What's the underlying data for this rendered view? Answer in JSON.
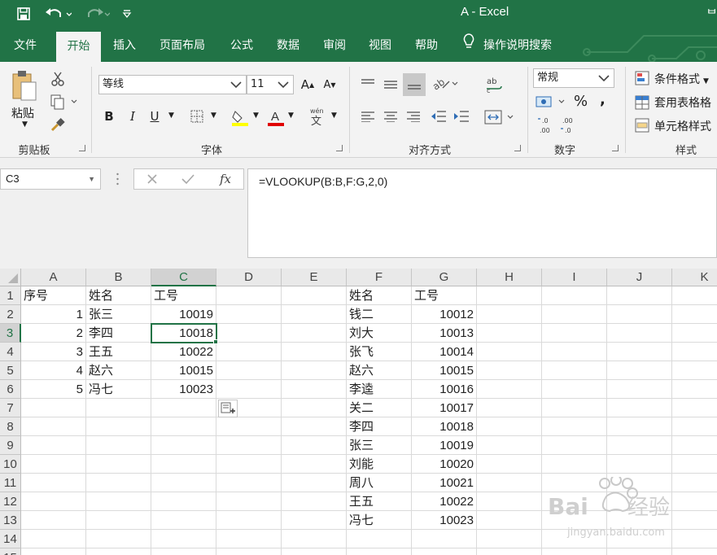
{
  "window": {
    "title": "A  -  Excel"
  },
  "tabs": [
    {
      "id": "file",
      "label": "文件"
    },
    {
      "id": "home",
      "label": "开始",
      "active": true
    },
    {
      "id": "insert",
      "label": "插入"
    },
    {
      "id": "layout",
      "label": "页面布局"
    },
    {
      "id": "formulas",
      "label": "公式"
    },
    {
      "id": "data",
      "label": "数据"
    },
    {
      "id": "review",
      "label": "审阅"
    },
    {
      "id": "view",
      "label": "视图"
    },
    {
      "id": "help",
      "label": "帮助"
    }
  ],
  "tell_me": {
    "label": "操作说明搜索",
    "icon": "lightbulb-icon"
  },
  "ribbon": {
    "clipboard": {
      "label": "剪贴板",
      "paste_label": "粘贴"
    },
    "font": {
      "label": "字体",
      "font_name": "等线",
      "font_size": "11"
    },
    "alignment": {
      "label": "对齐方式"
    },
    "number": {
      "label": "数字",
      "format": "常规",
      "percent": "%",
      "comma": ","
    },
    "styles": {
      "label": "样式",
      "conditional": "条件格式",
      "table": "套用表格格",
      "cell_styles": "单元格样式"
    }
  },
  "formula_bar": {
    "name_box": "C3",
    "formula": "=VLOOKUP(B:B,F:G,2,0)",
    "fx": "fx"
  },
  "grid": {
    "columns": [
      "A",
      "B",
      "C",
      "D",
      "E",
      "F",
      "G",
      "H",
      "I",
      "J",
      "K"
    ],
    "selected_column": "C",
    "selected_row": 3,
    "rows": [
      [
        "序号",
        "姓名",
        "工号",
        "",
        "",
        "姓名",
        "工号",
        "",
        "",
        "",
        ""
      ],
      [
        "1",
        "张三",
        "10019",
        "",
        "",
        "钱二",
        "10012",
        "",
        "",
        "",
        ""
      ],
      [
        "2",
        "李四",
        "10018",
        "",
        "",
        "刘大",
        "10013",
        "",
        "",
        "",
        ""
      ],
      [
        "3",
        "王五",
        "10022",
        "",
        "",
        "张飞",
        "10014",
        "",
        "",
        "",
        ""
      ],
      [
        "4",
        "赵六",
        "10015",
        "",
        "",
        "赵六",
        "10015",
        "",
        "",
        "",
        ""
      ],
      [
        "5",
        "冯七",
        "10023",
        "",
        "",
        "李逵",
        "10016",
        "",
        "",
        "",
        ""
      ],
      [
        "",
        "",
        "",
        "",
        "",
        "关二",
        "10017",
        "",
        "",
        "",
        ""
      ],
      [
        "",
        "",
        "",
        "",
        "",
        "李四",
        "10018",
        "",
        "",
        "",
        ""
      ],
      [
        "",
        "",
        "",
        "",
        "",
        "张三",
        "10019",
        "",
        "",
        "",
        ""
      ],
      [
        "",
        "",
        "",
        "",
        "",
        "刘能",
        "10020",
        "",
        "",
        "",
        ""
      ],
      [
        "",
        "",
        "",
        "",
        "",
        "周八",
        "10021",
        "",
        "",
        "",
        ""
      ],
      [
        "",
        "",
        "",
        "",
        "",
        "王五",
        "10022",
        "",
        "",
        "",
        ""
      ],
      [
        "",
        "",
        "",
        "",
        "",
        "冯七",
        "10023",
        "",
        "",
        "",
        ""
      ],
      [
        "",
        "",
        "",
        "",
        "",
        "",
        "",
        "",
        "",
        "",
        ""
      ],
      [
        "",
        "",
        "",
        "",
        "",
        "",
        "",
        "",
        "",
        "",
        ""
      ]
    ]
  },
  "watermark": {
    "brand": "Baidu经验",
    "url": "jingyan.baidu.com"
  },
  "colors": {
    "accent": "#217346",
    "ribbon_bg": "#f3f3f3",
    "header_bg": "#e9e9e9"
  }
}
